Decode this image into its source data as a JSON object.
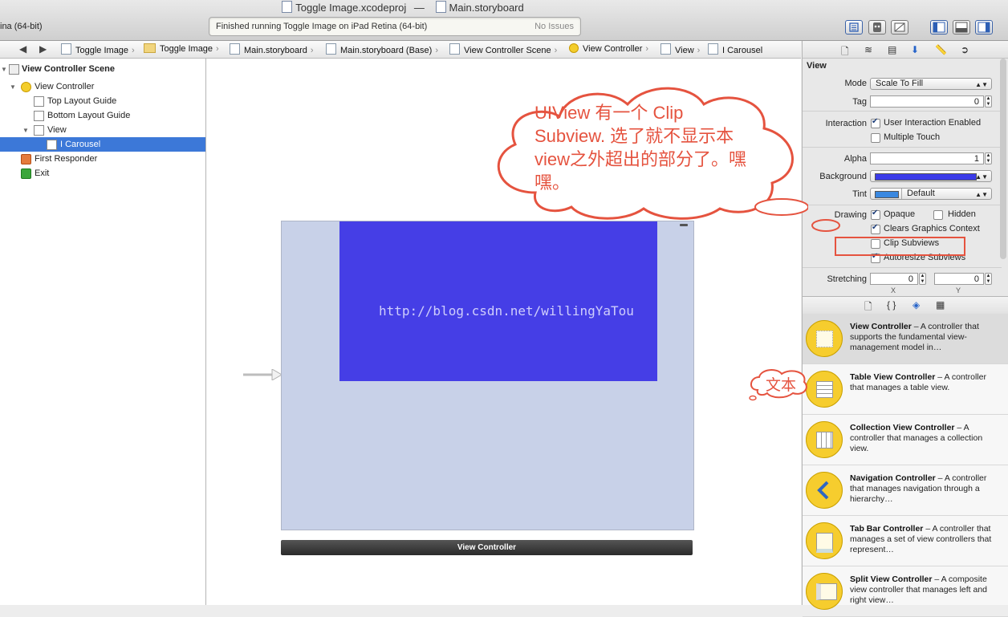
{
  "window": {
    "project_file": "Toggle Image.xcodeproj",
    "separator": "—",
    "storyboard_file": "Main.storyboard"
  },
  "toolbar": {
    "scheme_label": "ina (64-bit)",
    "activity_text": "Finished running Toggle Image on iPad Retina (64-bit)",
    "issues_text": "No Issues"
  },
  "jumpbar": {
    "crumbs": [
      "Toggle Image",
      "Toggle Image",
      "Main.storyboard",
      "Main.storyboard (Base)",
      "View Controller Scene",
      "View Controller",
      "View",
      "I Carousel"
    ]
  },
  "outline": {
    "items": [
      {
        "label": "View Controller Scene",
        "bold": true
      },
      {
        "label": "View Controller"
      },
      {
        "label": "Top Layout Guide"
      },
      {
        "label": "Bottom Layout Guide"
      },
      {
        "label": "View"
      },
      {
        "label": "I Carousel",
        "selected": true
      },
      {
        "label": "First Responder"
      },
      {
        "label": "Exit"
      }
    ]
  },
  "canvas": {
    "watermark": "http://blog.csdn.net/willingYaTou",
    "scene_dock_label": "View Controller",
    "scene_color": "#c8d1e8",
    "carousel_color": "#453ee6"
  },
  "inspector": {
    "section_title": "View",
    "mode": {
      "label": "Mode",
      "value": "Scale To Fill"
    },
    "tag": {
      "label": "Tag",
      "value": "0"
    },
    "interaction": {
      "label": "Interaction",
      "user_interaction": "User Interaction Enabled",
      "multiple_touch": "Multiple Touch"
    },
    "alpha": {
      "label": "Alpha",
      "value": "1"
    },
    "background": {
      "label": "Background",
      "color": "#3b3be8"
    },
    "tint": {
      "label": "Tint",
      "value": "Default",
      "color": "#3a88e0"
    },
    "drawing": {
      "label": "Drawing",
      "opaque": "Opaque",
      "hidden": "Hidden",
      "clears_graphics": "Clears Graphics Context",
      "clip_subviews": "Clip Subviews",
      "autoresize_subviews": "Autoresize Subviews"
    },
    "stretching": {
      "label": "Stretching",
      "x_value": "0",
      "y_value": "0",
      "x_caption": "X",
      "y_caption": "Y"
    }
  },
  "library": {
    "items": [
      {
        "name": "View Controller",
        "desc": " – A controller that supports the fundamental view-management model in…"
      },
      {
        "name": "Table View Controller",
        "desc": " – A controller that manages a table view."
      },
      {
        "name": "Collection View Controller",
        "desc": " – A controller that manages a collection view."
      },
      {
        "name": "Navigation Controller",
        "desc": " – A controller that manages navigation through a hierarchy…"
      },
      {
        "name": "Tab Bar Controller",
        "desc": " – A controller that manages a set of view controllers that represent…"
      },
      {
        "name": "Split View Controller",
        "desc": " – A composite view controller that manages left and right view…"
      }
    ]
  },
  "annotations": {
    "cloud_text": "UIView 有一个 Clip Subview. 选了就不显示本view之外超出的部分了。嘿嘿。",
    "bubble_text": "文本",
    "accent_color": "#e5533f"
  }
}
